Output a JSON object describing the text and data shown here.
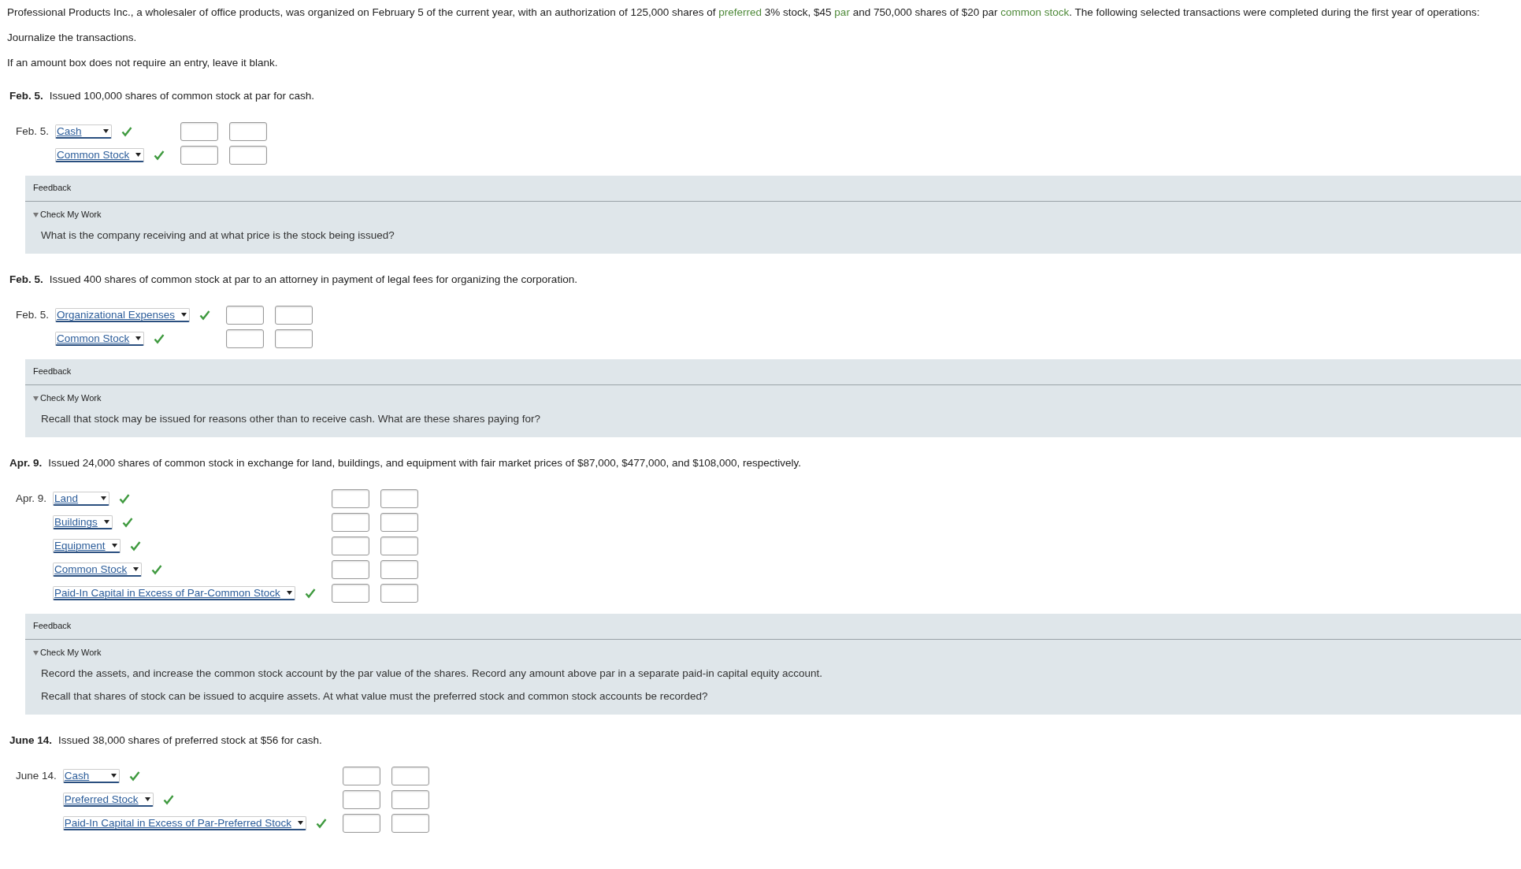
{
  "intro": [
    {
      "kind": "plain",
      "text": "Professional Products Inc., a wholesaler of office products, was organized on February 5 of the current year, with an authorization of 125,000 shares of "
    },
    {
      "kind": "term",
      "text": "preferred"
    },
    {
      "kind": "plain",
      "text": " 3% stock, $45 "
    },
    {
      "kind": "term",
      "text": "par"
    },
    {
      "kind": "plain",
      "text": " and 750,000 shares of $20 par "
    },
    {
      "kind": "term",
      "text": "common stock"
    },
    {
      "kind": "plain",
      "text": ". The following selected transactions were completed during the first year of operations:"
    }
  ],
  "instructions": [
    "Journalize the transactions.",
    "If an amount box does not require an entry, leave it blank."
  ],
  "transactions": [
    {
      "date": "Feb. 5.",
      "description": "Issued 100,000 shares of common stock at par for cash.",
      "entry_date": "Feb. 5.",
      "lines": [
        {
          "account": "Cash",
          "correct": true
        },
        {
          "account": "Common Stock",
          "correct": true
        }
      ],
      "feedback": {
        "title": "Feedback",
        "toggle": "Check My Work",
        "expanded": true,
        "paragraphs": [
          "What is the company receiving and at what price is the stock being issued?"
        ]
      }
    },
    {
      "date": "Feb. 5.",
      "description": "Issued 400 shares of common stock at par to an attorney in payment of legal fees for organizing the corporation.",
      "entry_date": "Feb. 5.",
      "lines": [
        {
          "account": "Organizational Expenses",
          "correct": true
        },
        {
          "account": "Common Stock",
          "correct": true
        }
      ],
      "feedback": {
        "title": "Feedback",
        "toggle": "Check My Work",
        "expanded": true,
        "paragraphs": [
          "Recall that stock may be issued for reasons other than to receive cash. What are these shares paying for?"
        ]
      }
    },
    {
      "date": "Apr. 9.",
      "description": "Issued 24,000 shares of common stock in exchange for land, buildings, and equipment with fair market prices of $87,000, $477,000, and $108,000, respectively.",
      "entry_date": "Apr. 9.",
      "lines": [
        {
          "account": "Land",
          "correct": true
        },
        {
          "account": "Buildings",
          "correct": true
        },
        {
          "account": "Equipment",
          "correct": true
        },
        {
          "account": "Common Stock",
          "correct": true
        },
        {
          "account": "Paid-In Capital in Excess of Par-Common Stock",
          "correct": true
        }
      ],
      "feedback": {
        "title": "Feedback",
        "toggle": "Check My Work",
        "expanded": true,
        "paragraphs": [
          "Record the assets, and increase the common stock account by the par value of the shares. Record any amount above par in a separate paid-in capital equity account.",
          "Recall that shares of stock can be issued to acquire assets. At what value must the preferred stock and common stock accounts be recorded?"
        ]
      }
    },
    {
      "date": "June 14.",
      "description": "Issued 38,000 shares of preferred stock at $56 for cash.",
      "entry_date": "June 14.",
      "lines": [
        {
          "account": "Cash",
          "correct": true
        },
        {
          "account": "Preferred Stock",
          "correct": true
        },
        {
          "account": "Paid-In Capital in Excess of Par-Preferred Stock",
          "correct": true
        }
      ]
    }
  ]
}
